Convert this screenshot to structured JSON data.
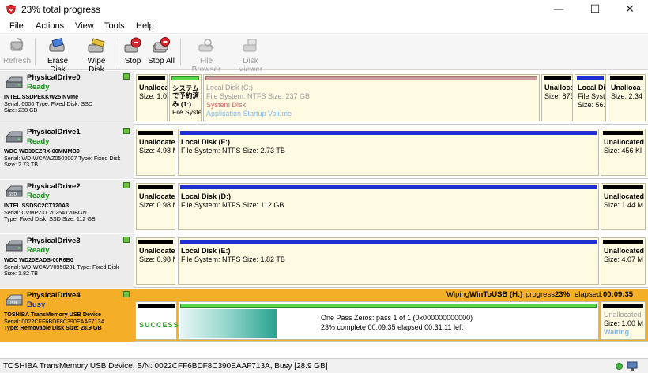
{
  "window": {
    "title": "23% total progress",
    "minimize": "—",
    "maximize": "☐",
    "close": "✕"
  },
  "menu": [
    "File",
    "Actions",
    "View",
    "Tools",
    "Help"
  ],
  "toolbar": {
    "refresh": "Refresh",
    "erase_disk": "Erase Disk",
    "wipe_disk": "Wipe Disk",
    "stop": "Stop",
    "stop_all": "Stop All",
    "file_browser": "File Browser",
    "disk_viewer": "Disk Viewer"
  },
  "drives": [
    {
      "name": "PhysicalDrive0",
      "status": "Ready",
      "model": "INTEL SSDPEKKW25 NVMe",
      "line1": "Serial: 0000 Type: Fixed Disk, SSD",
      "line2": "Size: 238 GB",
      "partitions": [
        {
          "title": "Unalloca",
          "size": "Size: 1.00"
        },
        {
          "title": "システム",
          "sub": "で予約済",
          "sub2": "み (1:)",
          "sub3": "File Syster"
        },
        {
          "title": "Local Disk (C:)",
          "fs": "File System: NTFS Size: 237 GB",
          "note1": "System Disk",
          "note2": "Application Startup Volume"
        },
        {
          "title": "Unalloca",
          "size": "Size: 873"
        },
        {
          "title": "Local Dis",
          "fs": "File Syste",
          "size": "Size: 561"
        },
        {
          "title": "Unalloca",
          "size": "Size: 2.34"
        }
      ]
    },
    {
      "name": "PhysicalDrive1",
      "status": "Ready",
      "model": "WDC WD30EZRX-00MMMB0",
      "line1": "Serial: WD-WCAWZ0503007 Type: Fixed Disk",
      "line2": "Size: 2.73 TB",
      "partitions": [
        {
          "title": "Unallocated",
          "size": "Size: 4.98 M"
        },
        {
          "title": "Local Disk (F:)",
          "fs": "File System: NTFS Size: 2.73 TB"
        },
        {
          "title": "Unallocated",
          "size": "Size: 456 Kl"
        }
      ]
    },
    {
      "name": "PhysicalDrive2",
      "status": "Ready",
      "model": "INTEL SSDSC2CT120A3",
      "line1": "Serial: CVMP231 20254120BGN",
      "line2": "Type: Fixed Disk, SSD  Size: 112 GB",
      "partitions": [
        {
          "title": "Unallocated",
          "size": "Size: 0.98 M"
        },
        {
          "title": "Local Disk (D:)",
          "fs": "File System: NTFS Size: 112 GB"
        },
        {
          "title": "Unallocated",
          "size": "Size: 1.44 M"
        }
      ]
    },
    {
      "name": "PhysicalDrive3",
      "status": "Ready",
      "model": "WDC WD20EADS-00R6B0",
      "line1": "Serial: WD-WCAVY0950231 Type: Fixed Disk",
      "line2": "Size: 1.82 TB",
      "partitions": [
        {
          "title": "Unallocated",
          "size": "Size: 0.98 M"
        },
        {
          "title": "Local Disk (E:)",
          "fs": "File System: NTFS Size: 1.82 TB"
        },
        {
          "title": "Unallocated",
          "size": "Size: 4.07 M"
        }
      ]
    },
    {
      "name": "PhysicalDrive4",
      "status": "Busy",
      "model": "TOSHIBA TransMemory USB Device",
      "line1": "Serial: 0022CFF6BDF8C390EAAF713A",
      "line2": "Type: Removable Disk  Size: 28.9 GB",
      "wipe": {
        "target_prefix": "Wiping",
        "target": "WinToUSB (H:)",
        "progress_label": "progress:",
        "progress_value": "23%",
        "progress_fraction": 0.23,
        "elapsed_label": "elapsed:",
        "elapsed_value": "00:09:35",
        "result": "SUCCESS",
        "line1": "One Pass Zeros: pass 1 of 1 (0x000000000000)",
        "line2": "23% complete  00:09:35 elapsed   00:31:11 left"
      },
      "partitions": [
        {
          "title": "Unallocated",
          "size": "Size: 1.00 M",
          "note": "Waiting"
        }
      ]
    }
  ],
  "statusbar": {
    "text": "TOSHIBA TransMemory USB Device, S/N: 0022CFF6BDF8C390EAAF713A, Busy [28.9 GB]"
  }
}
